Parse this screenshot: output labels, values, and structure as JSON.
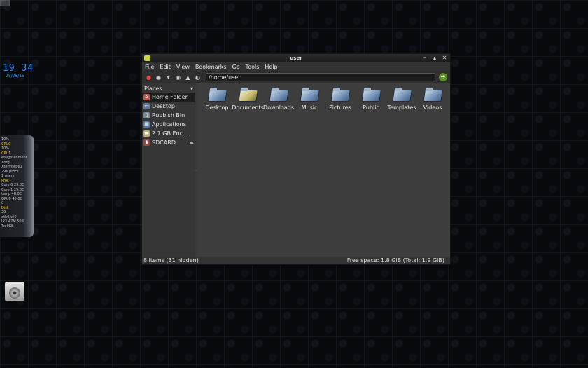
{
  "desktop": {
    "clock": {
      "time": "19 34",
      "date": "25/06/15"
    },
    "sysmon": {
      "rows": [
        "10%",
        "CPU0",
        "10%",
        "CPU1",
        "enlightenment",
        "Xorg",
        "Xtermfe861",
        "296 procs",
        "1 users",
        "Proc",
        "Core 0  29.0C",
        "Core 1  29.0C",
        "temp  40.0C",
        "GPU0  40.0C",
        "0",
        "Disk",
        "20",
        "eth0/wl0",
        "IRX  47M  50%",
        "Tx  0KB"
      ]
    }
  },
  "window": {
    "title": "user",
    "controls": {
      "minimize": "–",
      "maximize": "▴",
      "close": "✕"
    },
    "menu": [
      "File",
      "Edit",
      "View",
      "Bookmarks",
      "Go",
      "Tools",
      "Help"
    ],
    "toolbar": {
      "location": "/home/user",
      "go": "➔"
    },
    "sidebar": {
      "header": "Places",
      "items": [
        {
          "label": "Home Folder",
          "color": "#c0584a",
          "glyph": "⌂",
          "active": true
        },
        {
          "label": "Desktop",
          "color": "#5f7a9a",
          "glyph": "▭"
        },
        {
          "label": "Rubbish Bin",
          "color": "#7b8a99",
          "glyph": "▯"
        },
        {
          "label": "Applications",
          "color": "#4f7fb0",
          "glyph": "▦"
        },
        {
          "label": "2.7 GB Enc…",
          "color": "#b8b070",
          "glyph": "▬"
        },
        {
          "label": "SDCARD",
          "color": "#a04545",
          "glyph": "▮",
          "eject": "⏏"
        }
      ]
    },
    "files": [
      "Desktop",
      "Documents",
      "Downloads",
      "Music",
      "Pictures",
      "Public",
      "Templates",
      "Videos"
    ],
    "status": {
      "left": "8 items (31 hidden)",
      "right": "Free space: 1.8 GiB (Total: 1.9 GiB)"
    }
  }
}
